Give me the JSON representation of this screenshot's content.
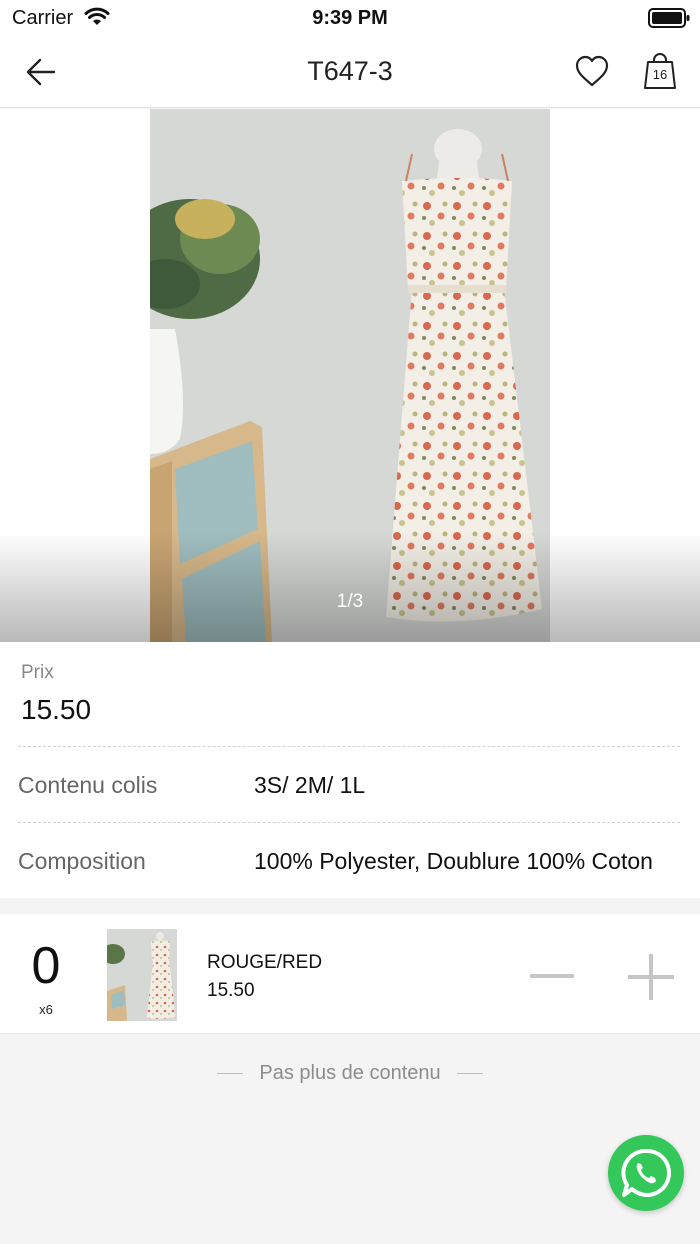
{
  "status_bar": {
    "carrier": "Carrier",
    "time": "9:39 PM"
  },
  "nav": {
    "title": "T647-3",
    "cart_count": "16"
  },
  "gallery": {
    "counter": "1/3"
  },
  "product": {
    "price_label": "Prix",
    "price": "15.50",
    "rows": [
      {
        "label": "Contenu colis",
        "value": "3S/ 2M/ 1L"
      },
      {
        "label": "Composition",
        "value": "100% Polyester, Doublure 100% Coton"
      }
    ]
  },
  "variant": {
    "quantity": "0",
    "pack": "x6",
    "color": "ROUGE/RED",
    "price": "15.50"
  },
  "footer": {
    "end_text": "Pas plus de contenu"
  },
  "icons": [
    "back-arrow-icon",
    "heart-icon",
    "shopping-bag-icon",
    "minus-icon",
    "plus-icon",
    "whatsapp-icon",
    "wifi-icon",
    "battery-icon"
  ],
  "colors": {
    "whatsapp": "#34c759",
    "background": "#f4f4f4"
  }
}
